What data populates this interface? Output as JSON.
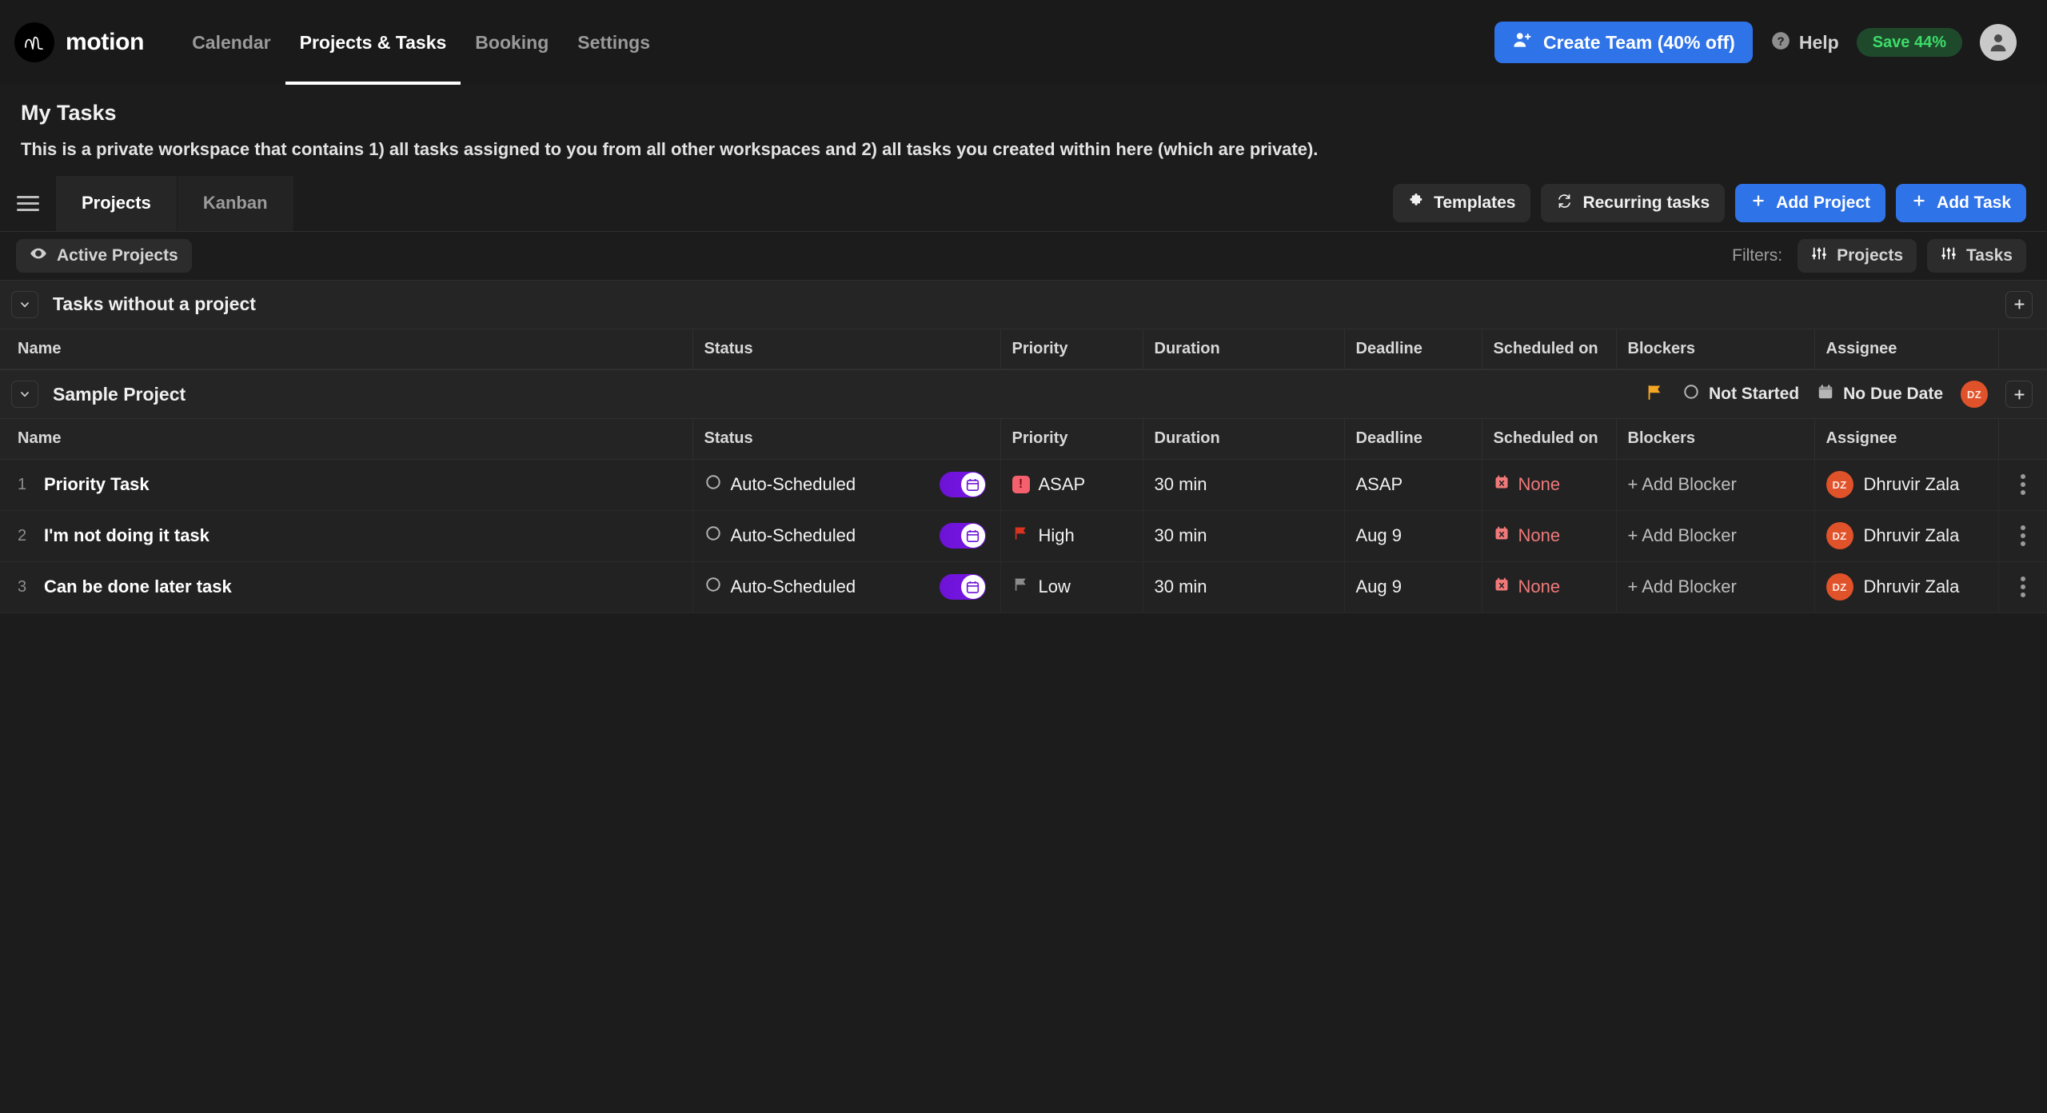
{
  "brand": {
    "name": "motion",
    "logo_icon": "motion-logo-icon"
  },
  "nav": {
    "items": [
      {
        "label": "Calendar",
        "active": false
      },
      {
        "label": "Projects & Tasks",
        "active": true
      },
      {
        "label": "Booking",
        "active": false
      },
      {
        "label": "Settings",
        "active": false
      }
    ]
  },
  "topbar_actions": {
    "create_team_label": "Create Team (40% off)",
    "create_team_icon": "person-plus-icon",
    "help_label": "Help",
    "help_icon": "question-circle-icon",
    "save_badge_label": "Save 44%",
    "avatar_icon": "user-avatar-icon",
    "accent_blue": "#2f73e8",
    "save_green": "#3ddc6a"
  },
  "page": {
    "title": "My Tasks",
    "description": "This is a private workspace that contains 1) all tasks assigned to you from all other workspaces and 2) all tasks you created within here (which are private)."
  },
  "toolbar": {
    "menu_icon": "hamburger-menu-icon",
    "tabs": [
      {
        "label": "Projects",
        "active": true
      },
      {
        "label": "Kanban",
        "active": false
      }
    ],
    "actions": [
      {
        "label": "Templates",
        "icon": "puzzle-piece-icon",
        "style": "ghost"
      },
      {
        "label": "Recurring tasks",
        "icon": "recurring-arrows-icon",
        "style": "ghost"
      },
      {
        "label": "Add Project",
        "icon": "plus-icon",
        "style": "primary"
      },
      {
        "label": "Add Task",
        "icon": "plus-icon",
        "style": "primary"
      }
    ]
  },
  "filters": {
    "active_projects_label": "Active Projects",
    "active_projects_icon": "eye-icon",
    "filters_label": "Filters:",
    "chips": [
      {
        "label": "Projects",
        "icon": "sliders-icon"
      },
      {
        "label": "Tasks",
        "icon": "sliders-icon"
      }
    ]
  },
  "groups": [
    {
      "title": "Tasks without a project",
      "caret_icon": "chevron-down-icon",
      "add_icon": "plus-icon",
      "meta": [],
      "columns": [
        "Name",
        "Status",
        "Priority",
        "Duration",
        "Deadline",
        "Scheduled on",
        "Blockers",
        "Assignee"
      ],
      "rows": []
    },
    {
      "title": "Sample Project",
      "caret_icon": "chevron-down-icon",
      "add_icon": "plus-icon",
      "meta": {
        "flag_icon": "flag-icon",
        "status_icon": "circle-outline-icon",
        "status_label": "Not Started",
        "due_icon": "calendar-icon",
        "due_label": "No Due Date",
        "avatar_initials": "DZ"
      },
      "columns": [
        "Name",
        "Status",
        "Priority",
        "Duration",
        "Deadline",
        "Scheduled on",
        "Blockers",
        "Assignee"
      ],
      "rows": [
        {
          "num": "1",
          "name": "Priority Task",
          "status_icon": "circle-outline-icon",
          "status": "Auto-Scheduled",
          "auto_toggle_icon": "calendar-toggle-icon",
          "priority": "ASAP",
          "priority_icon": "exclamation-square-icon",
          "duration": "30 min",
          "deadline": "ASAP",
          "scheduled_on": "None",
          "scheduled_icon": "calendar-x-icon",
          "blockers": "+ Add Blocker",
          "assignee": "Dhruvir Zala",
          "assignee_initials": "DZ",
          "menu_icon": "kebab-menu-icon"
        },
        {
          "num": "2",
          "name": "I'm not doing it task",
          "status_icon": "circle-outline-icon",
          "status": "Auto-Scheduled",
          "auto_toggle_icon": "calendar-toggle-icon",
          "priority": "High",
          "priority_icon": "flag-icon",
          "duration": "30 min",
          "deadline": "Aug 9",
          "scheduled_on": "None",
          "scheduled_icon": "calendar-x-icon",
          "blockers": "+ Add Blocker",
          "assignee": "Dhruvir Zala",
          "assignee_initials": "DZ",
          "menu_icon": "kebab-menu-icon"
        },
        {
          "num": "3",
          "name": "Can be done later task",
          "status_icon": "circle-outline-icon",
          "status": "Auto-Scheduled",
          "auto_toggle_icon": "calendar-toggle-icon",
          "priority": "Low",
          "priority_icon": "flag-icon",
          "duration": "30 min",
          "deadline": "Aug 9",
          "scheduled_on": "None",
          "scheduled_icon": "calendar-x-icon",
          "blockers": "+ Add Blocker",
          "assignee": "Dhruvir Zala",
          "assignee_initials": "DZ",
          "menu_icon": "kebab-menu-icon"
        }
      ]
    }
  ],
  "colors": {
    "accent_blue": "#2f73e8",
    "auto_purple": "#7a18e8",
    "asap_red": "#f4606e",
    "high_flag_red": "#d8341f",
    "low_flag_gray": "#8c8c8c",
    "project_flag_orange": "#f5a623",
    "avatar_orange": "#e0522a",
    "none_red": "#f07a7a"
  }
}
